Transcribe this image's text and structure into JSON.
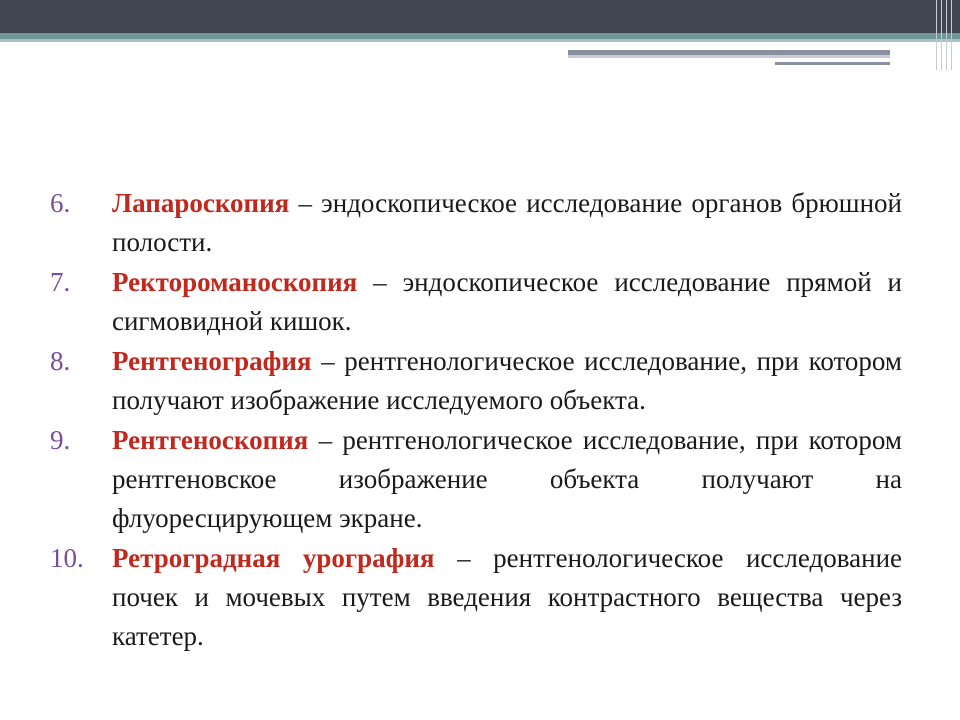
{
  "items": [
    {
      "number": "6.",
      "term": "Лапароскопия",
      "text": " – эндоскопическое исследование органов брюшной полости."
    },
    {
      "number": "7.",
      "term": "Ректороманоскопия",
      "text": " – эндоскопическое исследование прямой и сигмовидной кишок."
    },
    {
      "number": "8.",
      "term": "Рентгенография",
      "text": " – рентгенологическое исследование, при котором получают изображение исследуемого объекта."
    },
    {
      "number": "9.",
      "term": "Рентгеноскопия",
      "text": " – рентгенологическое исследование, при котором рентгеновское изображение объекта получают на флуоресцирующем экране."
    },
    {
      "number": "10.",
      "term": "Ретроградная урография",
      "text": " – рентгенологическое исследование почек и мочевых путем введения контрастного вещества через катетер."
    }
  ],
  "colors": {
    "term": "#c1281e",
    "number": "#7a4e9c",
    "topbar": "#414451",
    "accent_line": "#6f9797"
  }
}
